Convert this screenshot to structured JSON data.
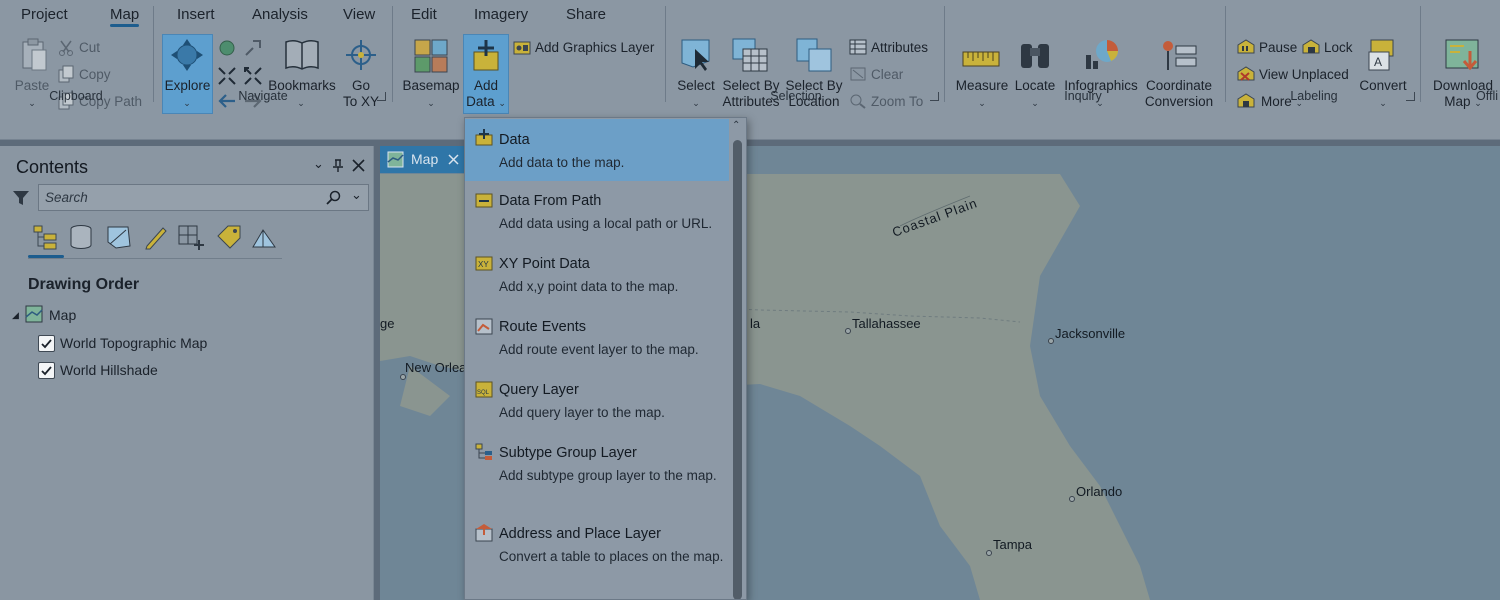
{
  "tabs": [
    "Project",
    "Map",
    "Insert",
    "Analysis",
    "View",
    "Edit",
    "Imagery",
    "Share"
  ],
  "active_tab": "Map",
  "ribbon": {
    "clipboard": {
      "paste": "Paste",
      "cut": "Cut",
      "copy": "Copy",
      "copy_path": "Copy Path",
      "label": "Clipboard"
    },
    "navigate": {
      "explore": "Explore",
      "bookmarks": "Bookmarks",
      "goto_line1": "Go",
      "goto_line2": "To XY",
      "label": "Navigate"
    },
    "layer": {
      "basemap": "Basemap",
      "add_line1": "Add",
      "add_line2": "Data",
      "add_graphics": "Add Graphics Layer"
    },
    "selection": {
      "select": "Select",
      "sba_line1": "Select By",
      "sba_line2": "Attributes",
      "sbl_line1": "Select By",
      "sbl_line2": "Location",
      "attributes": "Attributes",
      "clear": "Clear",
      "zoom_to": "Zoom To",
      "label": "Selection"
    },
    "inquiry": {
      "measure": "Measure",
      "locate": "Locate",
      "infographics": "Infographics",
      "cc_line1": "Coordinate",
      "cc_line2": "Conversion",
      "label": "Inquiry"
    },
    "labeling": {
      "pause": "Pause",
      "lock": "Lock",
      "view_unplaced": "View Unplaced",
      "more": "More",
      "convert": "Convert",
      "label": "Labeling"
    },
    "offline": {
      "dl_line1": "Download",
      "dl_line2": "Map",
      "label": "Offli"
    }
  },
  "contents": {
    "title": "Contents",
    "search_placeholder": "Search",
    "drawing_order": "Drawing Order",
    "map_node": "Map",
    "layers": [
      "World Topographic Map",
      "World Hillshade"
    ]
  },
  "map_view": {
    "tab_label": "Map",
    "labels": {
      "coastal_plain": "Coastal Plain",
      "tallahassee": "Tallahassee",
      "jacksonville": "Jacksonville",
      "orlando": "Orlando",
      "tampa": "Tampa",
      "new_orleans": "New Orlea",
      "ge": "ge",
      "la": "la"
    }
  },
  "add_data_menu": [
    {
      "title": "Data",
      "desc": "Add data to the map.",
      "icon": "add-data-icon",
      "selected": true
    },
    {
      "title": "Data From Path",
      "desc": "Add data using a local path or URL.",
      "icon": "path-icon"
    },
    {
      "title": "XY Point Data",
      "desc": "Add x,y point data to the map.",
      "icon": "xy-icon"
    },
    {
      "title": "Route Events",
      "desc": "Add route event layer to the map.",
      "icon": "route-icon"
    },
    {
      "title": "Query Layer",
      "desc": "Add query layer to the map.",
      "icon": "sql-icon"
    },
    {
      "title": "Subtype Group Layer",
      "desc": "Add subtype group layer to the map.",
      "icon": "subtype-icon"
    },
    {
      "title": "Address and Place Layer",
      "desc": "Convert a table to places on the map.",
      "icon": "address-icon"
    }
  ]
}
